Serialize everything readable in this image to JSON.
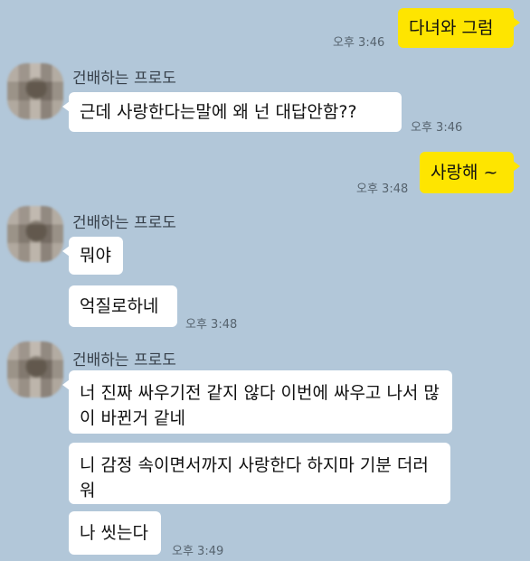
{
  "messages": [
    {
      "text": "다녀와 그럼",
      "time": "오후 3:46"
    },
    {
      "sender": "건배하는 프로도",
      "text": "근데 사랑한다는말에 왜 넌 대답안함??",
      "time": "오후 3:46"
    },
    {
      "text": "사랑해 ~",
      "time": "오후 3:48"
    },
    {
      "sender": "건배하는 프로도",
      "text": "뭐야"
    },
    {
      "text": "억질로하네",
      "time": "오후 3:48"
    },
    {
      "sender": "건배하는 프로도",
      "text": "너 진짜 싸우기전 같지 않다 이번에 싸우고 나서 많이 바뀐거 같네"
    },
    {
      "text": "니 감정 속이면서까지 사랑한다 하지마 기분 더러워"
    },
    {
      "text": "나 씻는다",
      "time": "오후 3:49"
    }
  ],
  "colors": {
    "background": "#b2c7d9",
    "my_bubble": "#fee500",
    "other_bubble": "#ffffff"
  }
}
